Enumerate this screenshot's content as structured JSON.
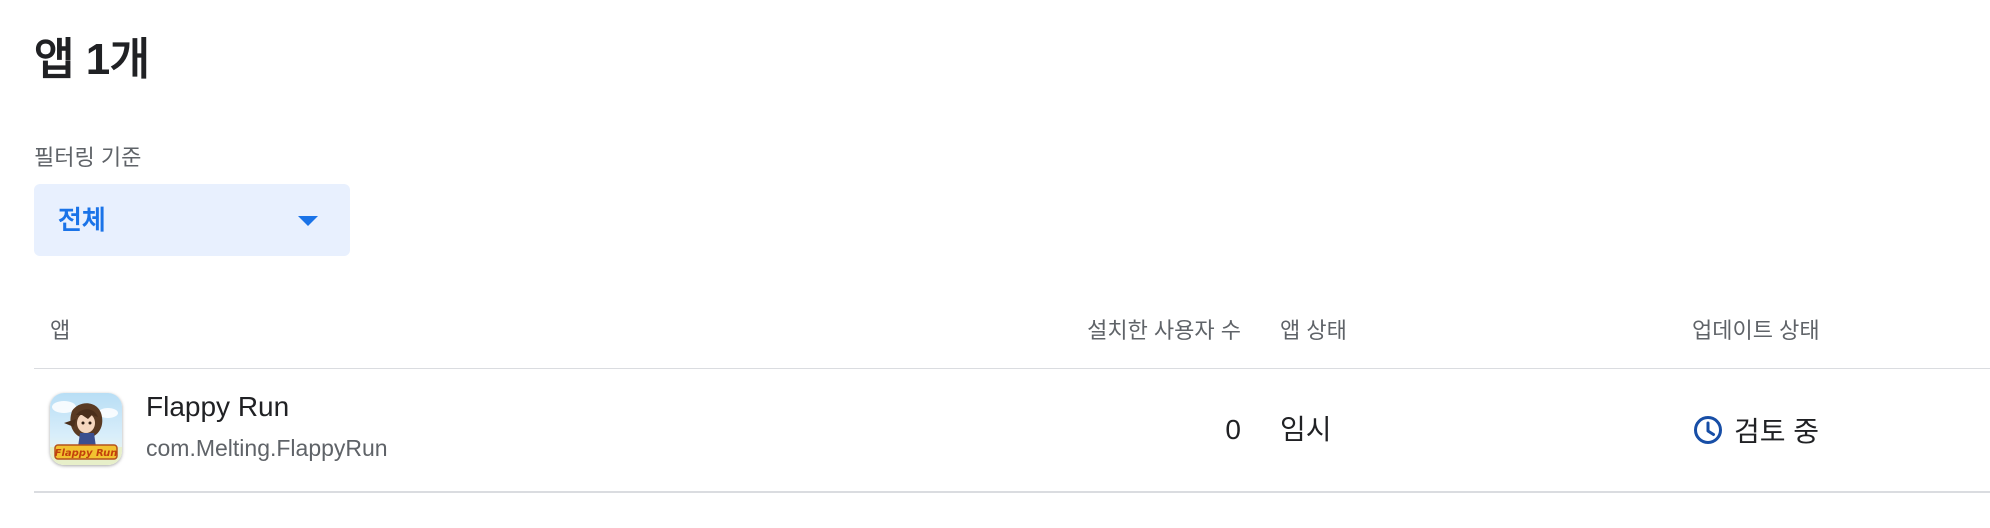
{
  "page": {
    "title": "앱 1개"
  },
  "filter": {
    "label": "필터링 기준",
    "selected": "전체",
    "caret_icon": "arrow-drop-down-icon"
  },
  "table": {
    "headers": {
      "app": "앱",
      "installs": "설치한 사용자 수",
      "app_status": "앱 상태",
      "update_status": "업데이트 상태"
    },
    "rows": [
      {
        "icon": "flappy-run-app-icon",
        "name": "Flappy Run",
        "package": "com.Melting.FlappyRun",
        "installs": "0",
        "app_status": "임시",
        "update_status": "검토 중",
        "update_status_icon": "clock-icon"
      }
    ]
  },
  "colors": {
    "accent": "#1a73e8",
    "filter_bg": "#e8f0fe",
    "clock_icon": "#174ea6",
    "divider": "#dadce0",
    "muted_text": "#5f6368"
  }
}
